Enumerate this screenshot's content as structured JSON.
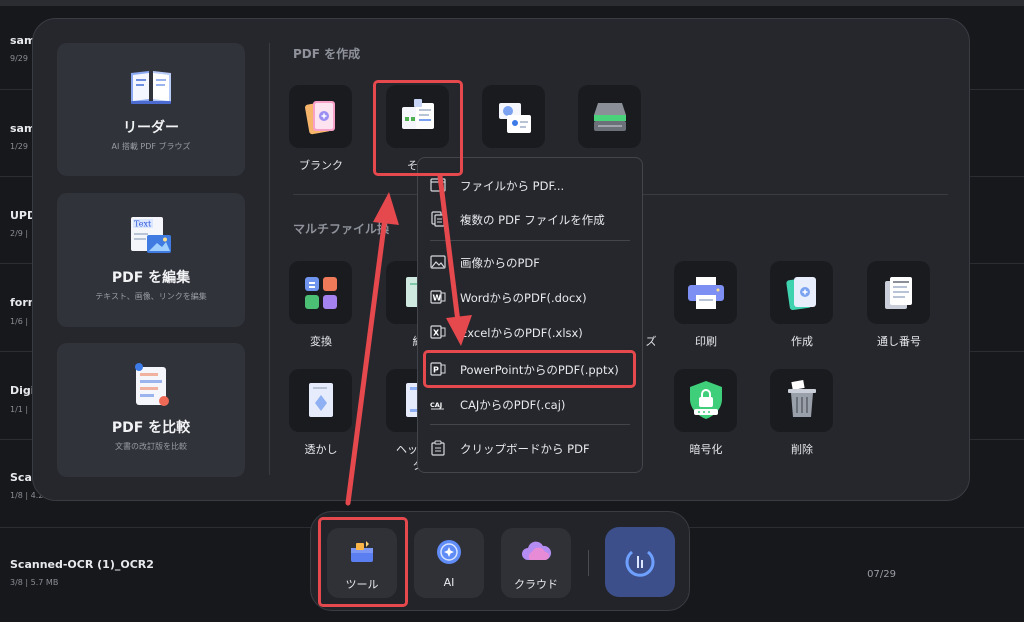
{
  "files": [
    {
      "name": "sam",
      "meta": "9/29"
    },
    {
      "name": "sam",
      "meta": "1/29"
    },
    {
      "name": "UPD",
      "meta": "2/9 |"
    },
    {
      "name": "form",
      "meta": "1/6 |"
    },
    {
      "name": "Digi",
      "meta": "1/1 |"
    },
    {
      "name": "Scan",
      "meta": "1/8 | 4.2"
    },
    {
      "name": "Scanned-OCR (1)_OCR2",
      "meta": "3/8 | 5.7 MB",
      "date": "07/29"
    }
  ],
  "left_cards": [
    {
      "title": "リーダー",
      "sub": "AI 搭載 PDF ブラウズ"
    },
    {
      "title": "PDF を編集",
      "sub": "テキスト、画像、リンクを編集"
    },
    {
      "title": "PDF を比較",
      "sub": "文書の改訂版を比較"
    }
  ],
  "sections": {
    "create": "PDF を作成",
    "multi": "マルチファイル操"
  },
  "create_tools": [
    {
      "label": "ブランク"
    },
    {
      "label": "その"
    }
  ],
  "row2_tools": [
    {
      "label": "変換"
    },
    {
      "label": "結"
    },
    {
      "label": "ズ"
    },
    {
      "label": "印刷"
    },
    {
      "label": "作成"
    },
    {
      "label": "通し番号"
    }
  ],
  "row3_tools": [
    {
      "label": "透かし"
    },
    {
      "label": "ヘッダー"
    },
    {
      "label": "タ"
    },
    {
      "label": "暗号化"
    },
    {
      "label": "削除"
    }
  ],
  "menu": [
    {
      "label": "ファイルから PDF..."
    },
    {
      "label": "複数の PDF ファイルを作成"
    },
    {
      "label": "画像からのPDF"
    },
    {
      "label": "WordからのPDF(.docx)"
    },
    {
      "label": "ExcelからのPDF(.xlsx)"
    },
    {
      "label": "PowerPointからのPDF(.pptx)"
    },
    {
      "label": "CAJからのPDF(.caj)"
    },
    {
      "label": "クリップボードから PDF"
    }
  ],
  "dock": {
    "tools": "ツール",
    "ai": "AI",
    "cloud": "クラウド"
  },
  "colors": {
    "highlight": "#e5484d",
    "accent": "#3d4f8a"
  }
}
